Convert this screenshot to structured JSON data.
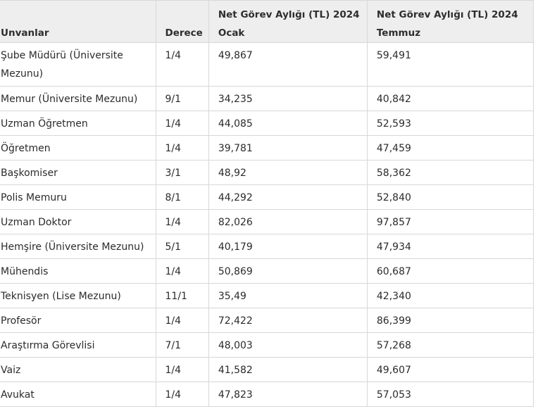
{
  "table": {
    "headers": {
      "unvanlar": "Unvanlar",
      "derece": "Derece",
      "ocak_line1": "Net Görev Aylığı (TL) 2024",
      "ocak_line2": "Ocak",
      "temmuz_line1": "Net Görev Aylığı (TL) 2024",
      "temmuz_line2": "Temmuz"
    },
    "rows": [
      {
        "unvan": "Şube Müdürü (Üniversite Mezunu)",
        "derece": "1/4",
        "ocak": "49,867",
        "temmuz": "59,491"
      },
      {
        "unvan": "Memur (Üniversite Mezunu)",
        "derece": "9/1",
        "ocak": "34,235",
        "temmuz": "40,842"
      },
      {
        "unvan": "Uzman Öğretmen",
        "derece": "1/4",
        "ocak": "44,085",
        "temmuz": "52,593"
      },
      {
        "unvan": "Öğretmen",
        "derece": "1/4",
        "ocak": "39,781",
        "temmuz": "47,459"
      },
      {
        "unvan": "Başkomiser",
        "derece": "3/1",
        "ocak": "48,92",
        "temmuz": "58,362"
      },
      {
        "unvan": "Polis Memuru",
        "derece": "8/1",
        "ocak": "44,292",
        "temmuz": "52,840"
      },
      {
        "unvan": "Uzman Doktor",
        "derece": "1/4",
        "ocak": "82,026",
        "temmuz": "97,857"
      },
      {
        "unvan": "Hemşire (Üniversite Mezunu)",
        "derece": "5/1",
        "ocak": "40,179",
        "temmuz": "47,934"
      },
      {
        "unvan": "Mühendis",
        "derece": "1/4",
        "ocak": "50,869",
        "temmuz": "60,687"
      },
      {
        "unvan": "Teknisyen (Lise Mezunu)",
        "derece": "11/1",
        "ocak": "35,49",
        "temmuz": "42,340"
      },
      {
        "unvan": "Profesör",
        "derece": "1/4",
        "ocak": "72,422",
        "temmuz": "86,399"
      },
      {
        "unvan": "Araştırma Görevlisi",
        "derece": "7/1",
        "ocak": "48,003",
        "temmuz": "57,268"
      },
      {
        "unvan": "Vaiz",
        "derece": "1/4",
        "ocak": "41,582",
        "temmuz": "49,607"
      },
      {
        "unvan": "Avukat",
        "derece": "1/4",
        "ocak": "47,823",
        "temmuz": "57,053"
      }
    ]
  }
}
